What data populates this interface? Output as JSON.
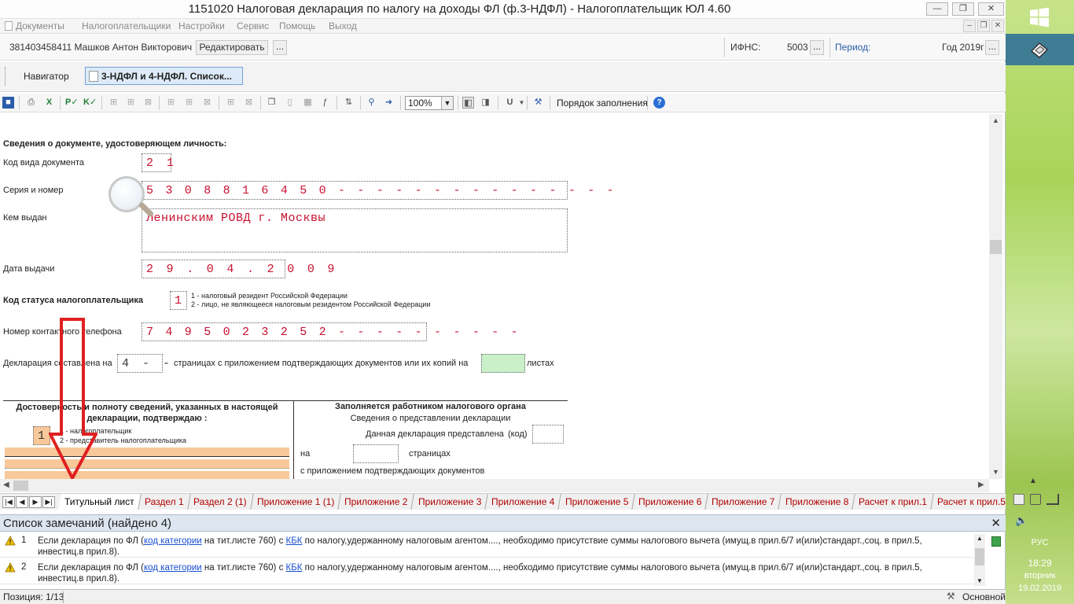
{
  "window": {
    "title": "1151020 Налоговая декларация по налогу на доходы ФЛ (ф.3-НДФЛ) - Налогоплательщик ЮЛ 4.60"
  },
  "menu": {
    "items": [
      "Документы",
      "Налогоплательщики",
      "Настройки",
      "Сервис",
      "Помощь",
      "Выход"
    ]
  },
  "infobar": {
    "taxpayer": "381403458411 Машков Антон Викторович",
    "edit_label": "Редактировать",
    "ellipsis": "...",
    "ifns_label": "ИФНС:",
    "ifns_value": "5003",
    "period_label": "Период:",
    "period_value": "Год 2019г"
  },
  "navigator": {
    "label": "Навигатор",
    "tab": "3-НДФЛ и 4-НДФЛ. Список..."
  },
  "toolbar": {
    "zoom": "100%",
    "fill_order": "Порядок заполнения"
  },
  "form": {
    "doc_heading": "Сведения о документе, удостоверяющем личность:",
    "doc_type_label": "Код вида документа",
    "doc_type_value": "2 1",
    "series_label": "Серия и номер",
    "series_value": "5 3   0 8   8 1 6 4 5 0 - - - - - - - - - - - - - - -",
    "issued_by_label": "Кем выдан",
    "issued_by_value": "Ленинским РОВД г. Москвы",
    "issue_date_label": "Дата выдачи",
    "issue_date_value": "2 9 . 0 4 . 2 0 0 9",
    "status_label": "Код статуса налогоплательщика",
    "status_value": "1",
    "status_note_1": "1 - налоговый резидент Российской Федерации",
    "status_note_2": "2 - лицо, не являющееся налоговым резидентом Российской Федерации",
    "phone_label": "Номер контактного телефона",
    "phone_value": "7 4 9 5 0 2 3 2 5 2 - - - - - - - - - -",
    "pages_label": "Декларация составлена на",
    "pages_value": "4 - -",
    "pages_text": "страницах с приложением подтверждающих документов или их копий на",
    "sheets_label": "листах",
    "reliability_heading": "Достоверность и полноту сведений, указанных в настоящей декларации, подтверждаю :",
    "reliability_value": "1",
    "reliability_opt_1": "1 - налогоплательщик",
    "reliability_opt_2": "2 - представитель налогоплательщика",
    "tax_officer_heading": "Заполняется работником налогового органа",
    "submission_info": "Сведения о представлении декларации",
    "submitted_label": "Данная декларация представлена",
    "code_label": "(код)",
    "on_label": "на",
    "pages_word": "страницах",
    "with_docs": "с приложением подтверждающих документов"
  },
  "sheet_tabs": [
    "Титульный лист",
    "Раздел 1",
    "Раздел 2 (1)",
    "Приложение 1 (1)",
    "Приложение 2",
    "Приложение 3",
    "Приложение 4",
    "Приложение 5",
    "Приложение 6",
    "Приложение 7",
    "Приложение 8",
    "Расчет к прил.1",
    "Расчет к прил.5"
  ],
  "remarks": {
    "title": "Список замечаний (найдено 4)",
    "items": [
      {
        "num": "1",
        "t1": "Если декларация по ФЛ (",
        "link1": "код категории",
        "t2": " на тит.листе 760) с ",
        "link2": "КБК",
        "t3": " по налогу,удержанному налоговым агентом...., необходимо присутствие суммы налогового вычета (имущ.в прил.6/7 и(или)стандарт.,соц. в прил.5, инвестиц.в прил.8)."
      },
      {
        "num": "2",
        "t1": "Если декларация по ФЛ (",
        "link1": "код категории",
        "t2": " на тит.листе 760) с ",
        "link2": "КБК",
        "t3": " по налогу,удержанному налоговым агентом...., необходимо присутствие суммы налогового вычета (имущ.в прил.6/7 и(или)стандарт.,соц. в прил.5, инвестиц.в прил.8)."
      }
    ]
  },
  "status": {
    "position": "Позиция: 1/13",
    "mode": "Основной"
  },
  "system": {
    "lang": "РУС",
    "time": "18:29",
    "weekday": "вторник",
    "date": "19.02.2019"
  },
  "colors": {
    "accent": "#c8102e",
    "arrow": "#e02020",
    "highlight_orange": "#f8c89a",
    "highlight_green": "#c9f0c9"
  }
}
